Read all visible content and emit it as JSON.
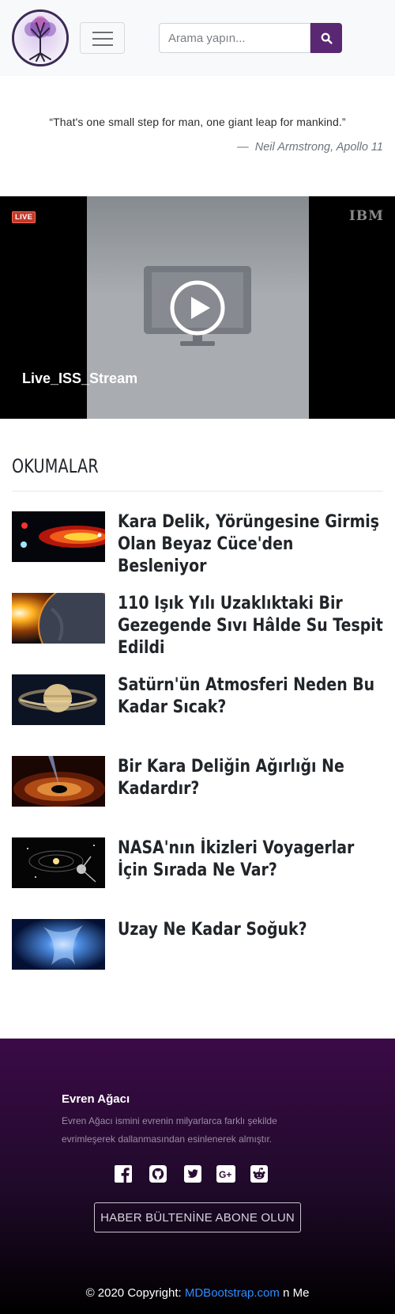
{
  "header": {
    "search_placeholder": "Arama yapın..."
  },
  "quote": {
    "text": "“That's one small step for man, one giant leap for mankind.”",
    "dash": "—",
    "author": "Neil Armstrong, Apollo 11"
  },
  "video": {
    "live_label": "LIVE",
    "brand": "IBM",
    "title": "Live_ISS_Stream"
  },
  "readings": {
    "title": "OKUMALAR",
    "articles": [
      {
        "title": "Kara Delik, Yörüngesine Girmiş Olan Beyaz Cüce'den Besleniyor"
      },
      {
        "title": "110 Işık Yılı Uzaklıktaki Bir Gezegende Sıvı Hâlde Su Tespit Edildi"
      },
      {
        "title": "Satürn'ün Atmosferi Neden Bu Kadar Sıcak?"
      },
      {
        "title": "Bir Kara Deliğin Ağırlığı Ne Kadardır?"
      },
      {
        "title": "NASA'nın İkizleri Voyagerlar İçin Sırada Ne Var?"
      },
      {
        "title": "Uzay Ne Kadar Soğuk?"
      }
    ]
  },
  "footer": {
    "title": "Evren Ağacı",
    "description": "Evren Ağacı ismini evrenin milyarlarca farklı şekilde evrimleşerek dallanmasından esinlenerek almıştır.",
    "subscribe_label": "HABER BÜLTENİNE ABONE OLUN",
    "copyright_prefix": "© 2020 Copyright: ",
    "copyright_link": "MDBootstrap.com",
    "copyright_suffix": " n Me",
    "social_icons": [
      "facebook-icon",
      "github-icon",
      "twitter-icon",
      "google-plus-icon",
      "reddit-icon"
    ]
  },
  "colors": {
    "brand_purple": "#5a2872",
    "footer_top": "#3b0a47",
    "link_blue": "#2e8cff"
  }
}
